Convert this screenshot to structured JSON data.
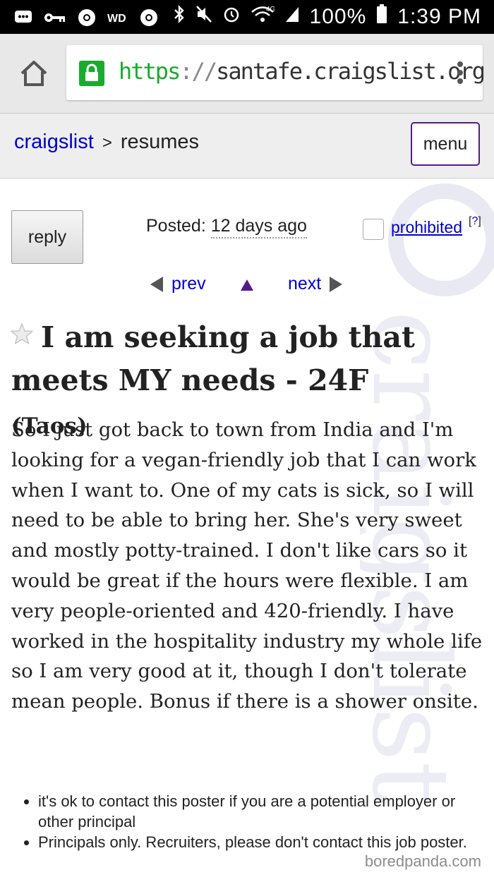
{
  "status_bar": {
    "battery": "100%",
    "time": "1:39 PM",
    "network": "4G",
    "icons": [
      "messages-icon",
      "key-icon",
      "chrome-icon",
      "wd-icon",
      "chrome-icon",
      "bluetooth-icon",
      "mute-icon",
      "alarm-icon",
      "wifi-icon",
      "signal-icon",
      "battery-icon"
    ]
  },
  "browser": {
    "url_scheme": "https",
    "url_sep": "://",
    "url_host": "santafe.craigslist.org"
  },
  "header": {
    "site": "craigslist",
    "separator": ">",
    "section": "resumes",
    "menu_label": "menu"
  },
  "posting": {
    "reply_label": "reply",
    "posted_label": "Posted:",
    "posted_value": "12 days ago",
    "prohibited_label": "prohibited",
    "help_mark": "?",
    "prev_label": "prev",
    "next_label": "next",
    "title": "I am seeking a job that meets MY needs - 24F",
    "location": "(Taos)",
    "body": "So I just got back to town from India and I'm looking for a vegan-friendly job that I can work when I want to. One of my cats is sick, so I will need to be able to bring her. She's very sweet and mostly potty-trained. I don't like cars so it would be great if the hours were flexible. I am very people-oriented and 420-friendly. I have worked in the hospitality industry my whole life so I am very good at it, though I don't tolerate mean people. Bonus if there is a shower onsite.",
    "notices": [
      "it's ok to contact this poster if you are a potential employer or other principal",
      "Principals only. Recruiters, please don't contact this job poster."
    ]
  },
  "watermark": "craigslist",
  "credit": "boredpanda.com",
  "colors": {
    "link": "#0000cc",
    "visited": "#551a8b",
    "lock_green": "#1aab2e"
  }
}
